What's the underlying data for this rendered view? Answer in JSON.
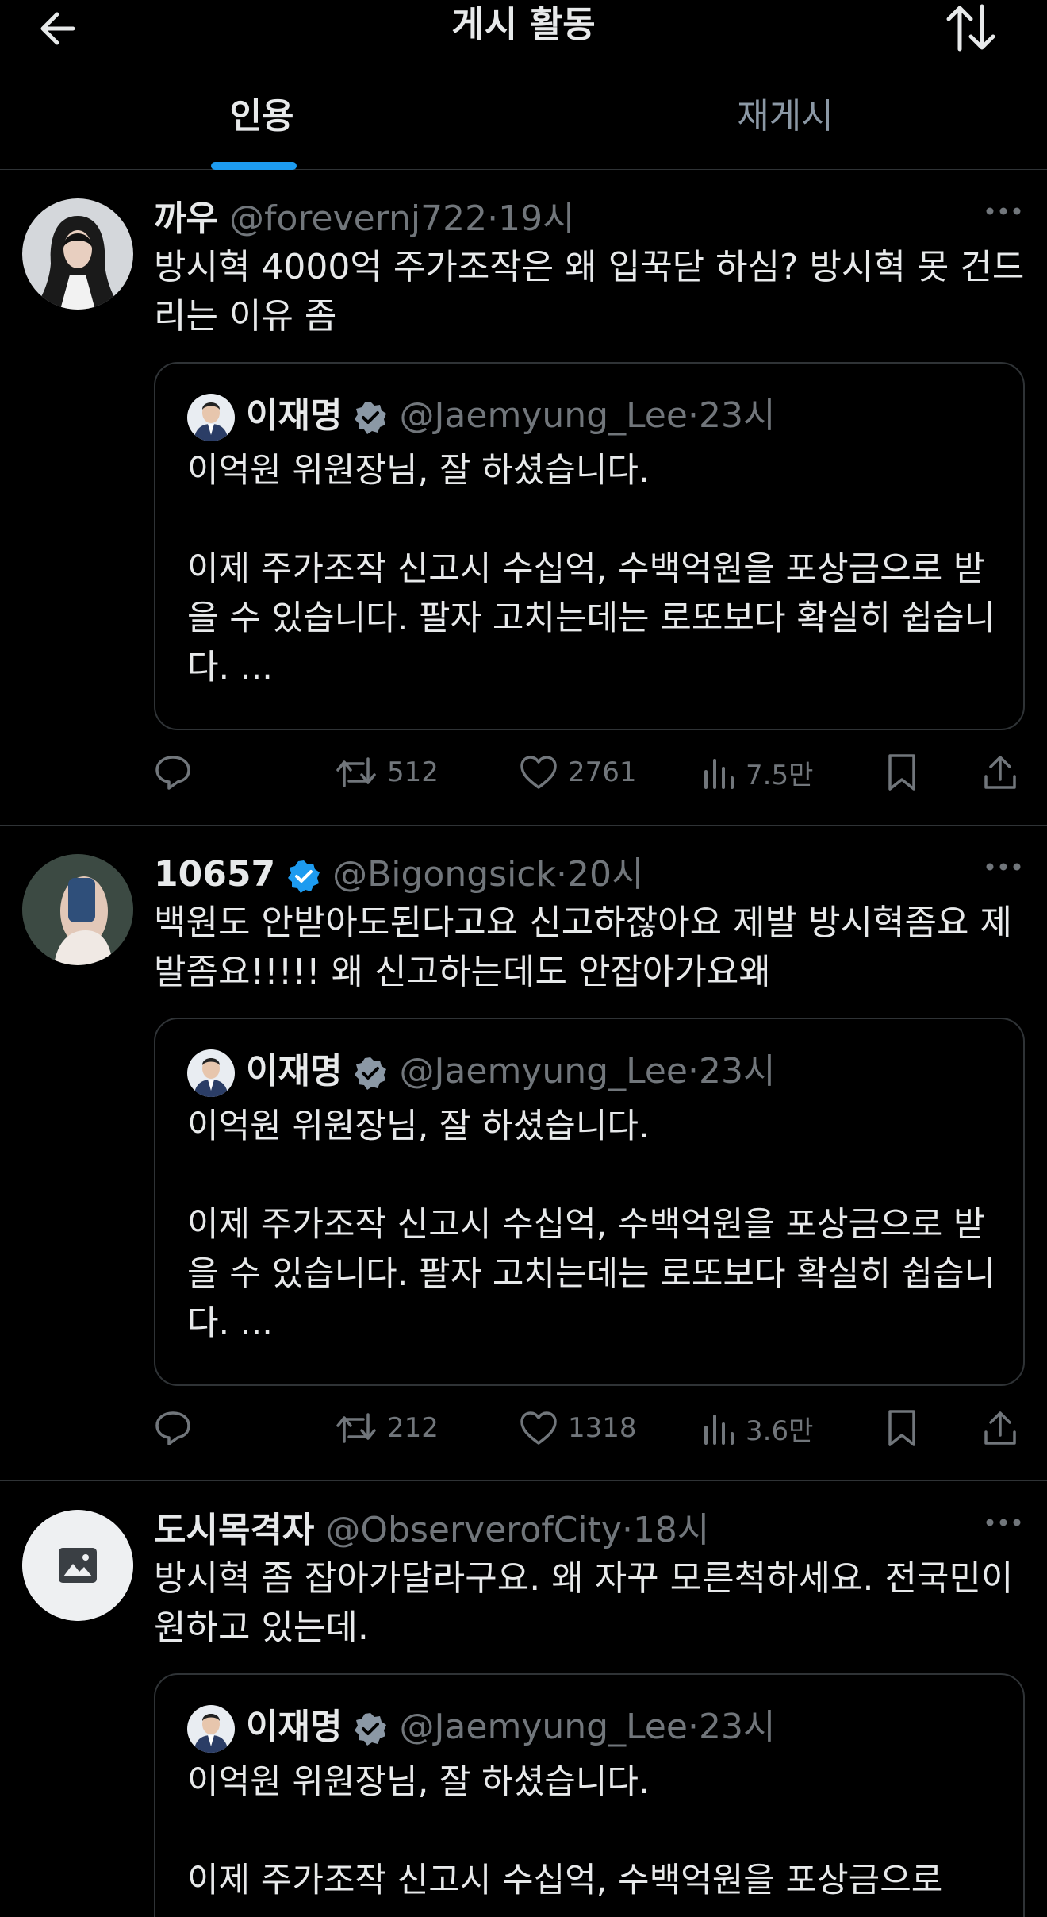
{
  "header": {
    "title": "게시 활동",
    "tabs": [
      {
        "label": "인용",
        "active": true
      },
      {
        "label": "재게시",
        "active": false
      }
    ]
  },
  "posts": [
    {
      "name": "까우",
      "handle": "@forevernj722",
      "time": "19시",
      "verified": false,
      "text": "방시혁 4000억 주가조작은 왜 입꾹닫 하심? 방시혁 못 건드리는 이유 좀",
      "quote": {
        "name": "이재명",
        "handle": "@Jaemyung_Lee",
        "time": "23시",
        "text": "이억원 위원장님, 잘 하셨습니다.\n\n이제 주가조작 신고시 수십억, 수백억원을 포상금으로 받을 수 있습니다. 팔자 고치는데는 로또보다 확실히 쉽습니다. ..."
      },
      "stats": {
        "reposts": "512",
        "likes": "2761",
        "views": "7.5만"
      }
    },
    {
      "name": "10657",
      "handle": "@Bigongsick",
      "time": "20시",
      "verified": true,
      "text": "백원도 안받아도된다고요 신고하잖아요 제발 방시혁좀요 제발좀요!!!!! 왜 신고하는데도 안잡아가요왜",
      "quote": {
        "name": "이재명",
        "handle": "@Jaemyung_Lee",
        "time": "23시",
        "text": "이억원 위원장님, 잘 하셨습니다.\n\n이제 주가조작 신고시 수십억, 수백억원을 포상금으로 받을 수 있습니다. 팔자 고치는데는 로또보다 확실히 쉽습니다. ..."
      },
      "stats": {
        "reposts": "212",
        "likes": "1318",
        "views": "3.6만"
      }
    },
    {
      "name": "도시목격자",
      "handle": "@ObserverofCity",
      "time": "18시",
      "verified": false,
      "text": "방시혁 좀 잡아가달라구요. 왜 자꾸 모른척하세요. 전국민이 원하고 있는데.",
      "quote": {
        "name": "이재명",
        "handle": "@Jaemyung_Lee",
        "time": "23시",
        "text": "이억원 위원장님, 잘 하셨습니다.\n\n이제 주가조작 신고시 수십억, 수백억원을 포상금으로"
      }
    }
  ],
  "separator": "·",
  "icons": {
    "back": "arrow-left-icon",
    "sort": "sort-arrows-icon",
    "more": "more-dots-icon",
    "verified": "verified-badge-icon",
    "reply": "reply-icon",
    "repost": "repost-icon",
    "like": "heart-icon",
    "views": "views-bar-chart-icon",
    "bookmark": "bookmark-icon",
    "share": "share-icon"
  },
  "colors": {
    "accent": "#1d9bf0",
    "muted": "#71767b",
    "text": "#e7e9ea",
    "border": "#2f3336"
  }
}
